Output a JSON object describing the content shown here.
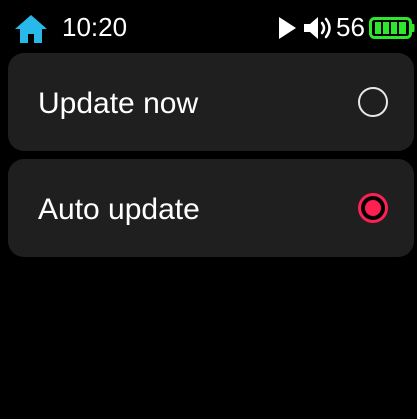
{
  "status_bar": {
    "time": "10:20",
    "volume": "56",
    "icons": {
      "home": "home-icon",
      "play": "play-icon",
      "volume": "volume-icon",
      "battery": "battery-icon"
    }
  },
  "options": [
    {
      "label": "Update now",
      "selected": false
    },
    {
      "label": "Auto update",
      "selected": true
    }
  ],
  "colors": {
    "background": "#000000",
    "row_background": "#1f1f1f",
    "accent": "#fe1f53",
    "home_icon": "#29b8ea",
    "battery": "#2ee62e"
  }
}
